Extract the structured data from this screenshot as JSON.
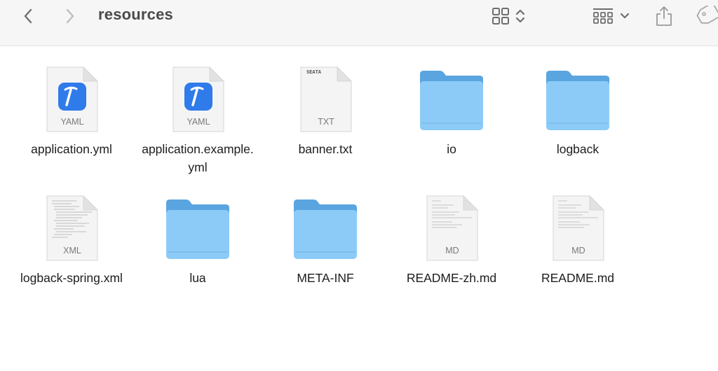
{
  "window": {
    "title": "resources"
  },
  "toolbar": {
    "back_icon": "chevron-left-icon",
    "forward_icon": "chevron-right-icon",
    "view_icon": "icon-grid-view-icon",
    "group_icon": "group-by-icon",
    "share_icon": "share-icon",
    "tag_icon": "tag-icon"
  },
  "colors": {
    "folder_front": "#8ccbf7",
    "folder_back": "#5aa5e0",
    "xcode_blue": "#2f7bea"
  },
  "files": [
    {
      "name": "application.yml",
      "kind": "yaml",
      "ext_label": "YAML"
    },
    {
      "name": "application.example.yml",
      "kind": "yaml",
      "ext_label": "YAML"
    },
    {
      "name": "banner.txt",
      "kind": "txt",
      "ext_label": "TXT",
      "preview": "SEATA"
    },
    {
      "name": "io",
      "kind": "folder"
    },
    {
      "name": "logback",
      "kind": "folder"
    },
    {
      "name": "logback-spring.xml",
      "kind": "xml",
      "ext_label": "XML"
    },
    {
      "name": "lua",
      "kind": "folder"
    },
    {
      "name": "META-INF",
      "kind": "folder"
    },
    {
      "name": "README-zh.md",
      "kind": "md",
      "ext_label": "MD"
    },
    {
      "name": "README.md",
      "kind": "md",
      "ext_label": "MD"
    }
  ]
}
